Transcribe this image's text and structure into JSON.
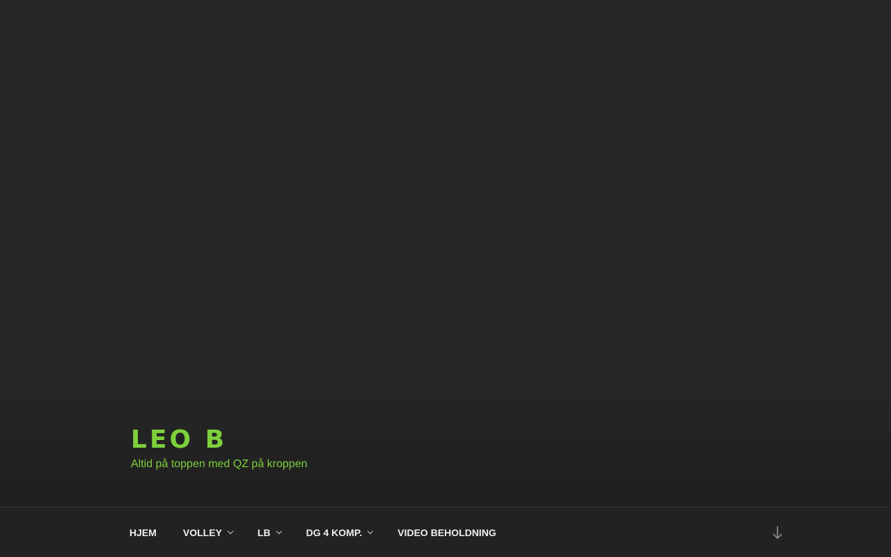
{
  "site": {
    "title": "LEO B",
    "tagline": "Altid på toppen med QZ på kroppen",
    "title_color": "#7ed03d",
    "tagline_color": "#7ed03d"
  },
  "nav": {
    "items": [
      {
        "label": "HJEM",
        "has_submenu": false
      },
      {
        "label": "VOLLEY",
        "has_submenu": true
      },
      {
        "label": "LB",
        "has_submenu": true
      },
      {
        "label": "DG 4 KOMP.",
        "has_submenu": true
      },
      {
        "label": "VIDEO BEHOLDNING",
        "has_submenu": false
      }
    ],
    "scroll_icon": "arrow-down-icon"
  },
  "colors": {
    "background": "#262626",
    "nav_background": "#222222",
    "nav_text": "#eeeeee",
    "accent": "#7ed03d"
  }
}
